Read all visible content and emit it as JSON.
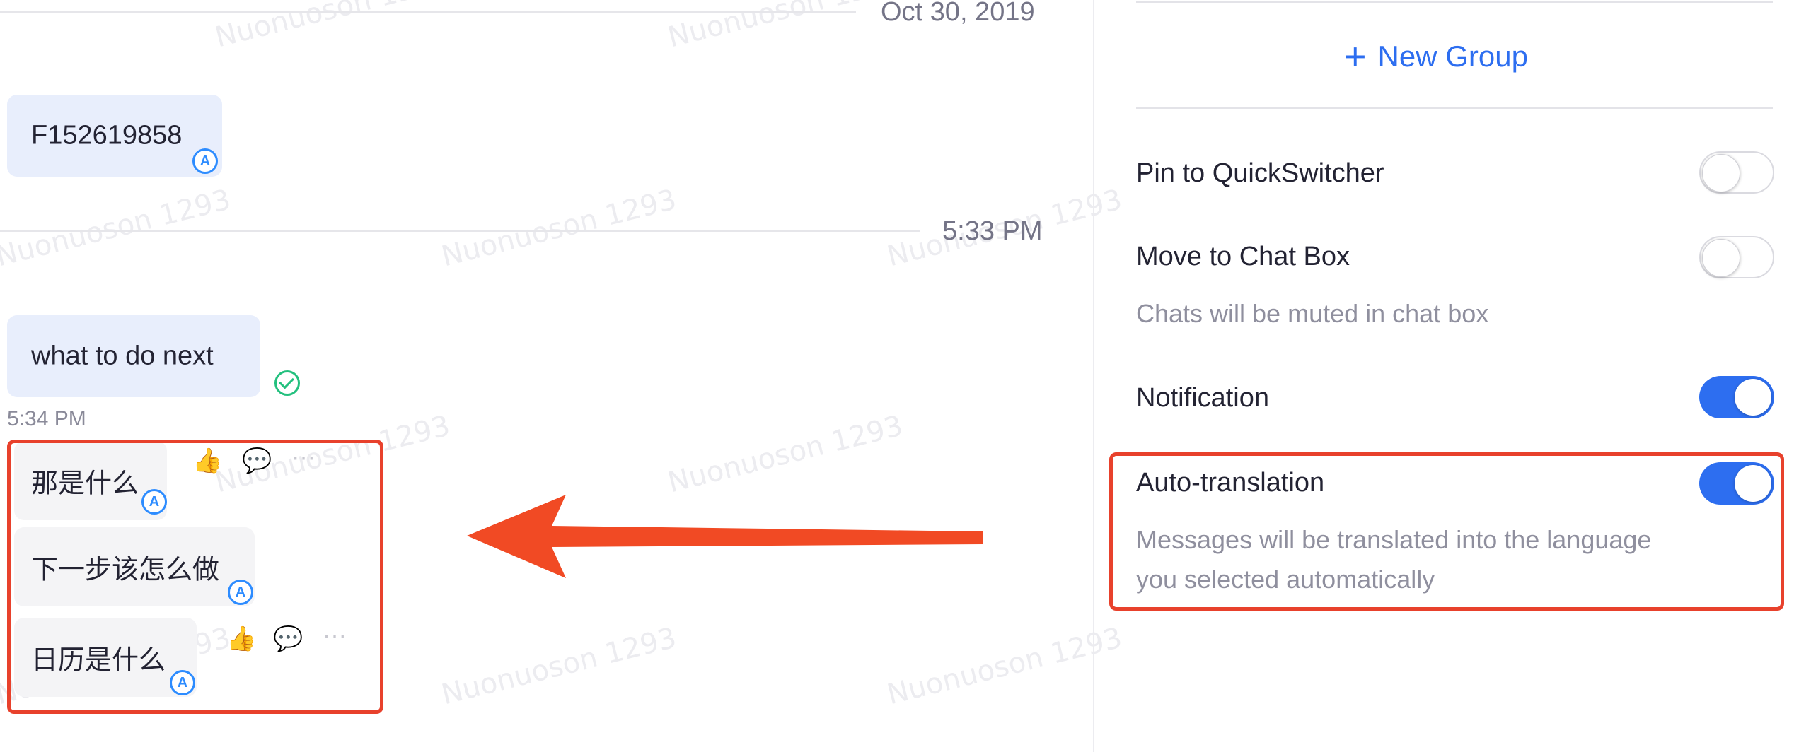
{
  "chat": {
    "date_label": "Oct 30, 2019",
    "time_label_1": "5:33 PM",
    "time_label_2": "5:34 PM",
    "messages": [
      {
        "text": "F152619858"
      },
      {
        "text": "what to do next"
      },
      {
        "text": "那是什么"
      },
      {
        "text": "下一步该怎么做"
      },
      {
        "text": "日历是什么"
      }
    ],
    "translate_icon_glyph": "A",
    "more_glyph": "···"
  },
  "settings": {
    "new_group_label": "New Group",
    "items": [
      {
        "label": "Pin to QuickSwitcher",
        "on": false
      },
      {
        "label": "Move to Chat Box",
        "on": false,
        "description": "Chats will be muted in chat box"
      },
      {
        "label": "Notification",
        "on": true
      },
      {
        "label": "Auto-translation",
        "on": true,
        "description_line1": "Messages will be translated into the language",
        "description_line2": "you selected automatically"
      }
    ]
  },
  "watermark_text": "Nuonuoson 1293",
  "colors": {
    "accent": "#2d6ef0",
    "highlight": "#e8412c",
    "bubble": "#e8eefc",
    "sent_check": "#23c07e"
  }
}
